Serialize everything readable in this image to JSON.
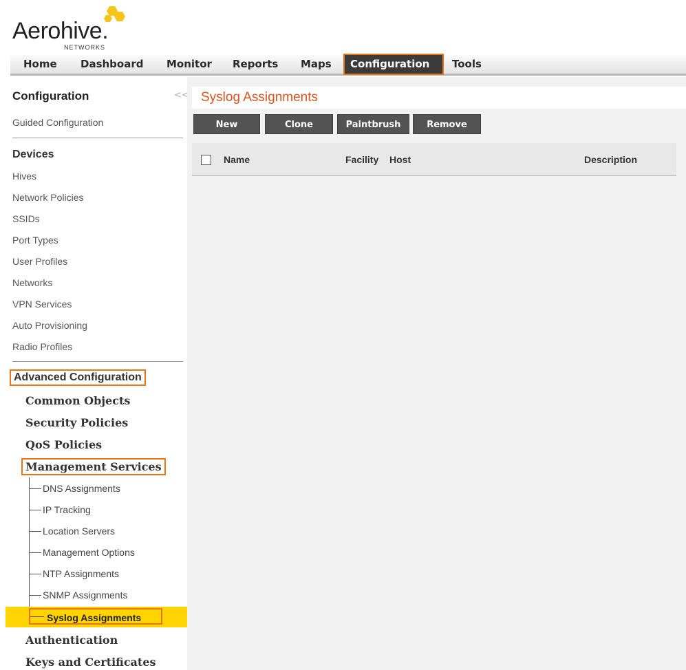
{
  "logo": {
    "name": "Aerohive.",
    "sub": "NETWORKS"
  },
  "nav": {
    "items": [
      {
        "label": "Home"
      },
      {
        "label": "Dashboard"
      },
      {
        "label": "Monitor"
      },
      {
        "label": "Reports"
      },
      {
        "label": "Maps"
      },
      {
        "label": "Configuration"
      },
      {
        "label": "Tools"
      }
    ],
    "active": "Configuration"
  },
  "sidebar": {
    "title": "Configuration",
    "collapse": "<<",
    "guided": "Guided Configuration",
    "devices_header": "Devices",
    "devices_items": [
      "Hives",
      "Network Policies",
      "SSIDs",
      "Port Types",
      "User Profiles",
      "Networks",
      "VPN Services",
      "Auto Provisioning",
      "Radio Profiles"
    ],
    "advanced_header": "Advanced Configuration",
    "advanced_items": {
      "common": "Common Objects",
      "security": "Security Policies",
      "qos": "QoS Policies",
      "management": "Management Services",
      "authentication": "Authentication",
      "keys": "Keys and Certificates"
    },
    "management_children": [
      "DNS Assignments",
      "IP Tracking",
      "Location Servers",
      "Management Options",
      "NTP Assignments",
      "SNMP Assignments"
    ],
    "selected": "Syslog Assignments"
  },
  "main": {
    "title": "Syslog Assignments",
    "toolbar": {
      "new": "New",
      "clone": "Clone",
      "paintbrush": "Paintbrush",
      "remove": "Remove"
    },
    "columns": {
      "name": "Name",
      "facility": "Facility",
      "host": "Host",
      "description": "Description"
    }
  },
  "colors": {
    "accent": "#e8751a",
    "title": "#d9531e",
    "selected_bg": "#ffd400",
    "nav_active_bg": "#3b3b3b",
    "button_bg": "#535353"
  }
}
